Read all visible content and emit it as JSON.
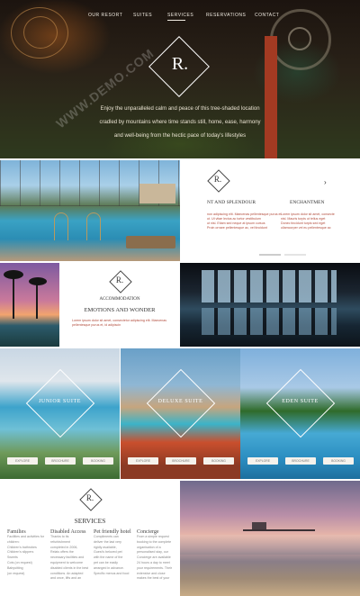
{
  "nav": {
    "items": [
      "OUR RESORT",
      "SUITES",
      "SERVICES",
      "RESERVATIONS",
      "CONTACT"
    ]
  },
  "hero": {
    "logo_letter": "R.",
    "lines": [
      "Enjoy the unparalleled calm and peace of this tree-shaded location",
      "cradled by mountains where time stands still, home, ease, harmony",
      "and well-being from the hectic pace of today's lifestyles"
    ]
  },
  "splendour": {
    "logo_letter": "R.",
    "headings": [
      "NT AND SPLENDOUR",
      "ENCHANTMEN"
    ],
    "text_left": [
      "non adipiscing elit. Maecenas pellentesque purus et",
      "ut. Ut vitae lectus ac tortor vestibulum",
      "ut nisl. Etiam sed neque at ipsum cursus",
      "Proin ornare pellentesque ac, vel tincidunt"
    ],
    "text_right": [
      "Lorem ipsum dolor sit amet, consecte",
      "nisl. Mauris turpis ut tellus eget",
      "Donec tincidunt turpis sed eget",
      "ullamcorper vel eu pellentesque ac"
    ]
  },
  "accommodation": {
    "logo_letter": "R.",
    "kicker": "ACCOMMODATION",
    "title": "EMOTIONS AND WONDER",
    "text": [
      "Lorem ipsum dolor sit amet, consectetur adipiscing elit. Maecenas",
      "pellentesque purus et, id adipiscin"
    ]
  },
  "suites": [
    {
      "name": "JUNIOR SUITE",
      "buttons": [
        "EXPLORE",
        "BROCHURE",
        "BOOKING"
      ]
    },
    {
      "name": "DELUXE SUITE",
      "buttons": [
        "EXPLORE",
        "BROCHURE",
        "BOOKING"
      ]
    },
    {
      "name": "EDEN SUITE",
      "buttons": [
        "EXPLORE",
        "BROCHURE",
        "BOOKING"
      ]
    }
  ],
  "services": {
    "logo_letter": "R.",
    "title": "SERVICES",
    "columns": [
      {
        "heading": "Families",
        "lines": [
          "Facilities and activities for",
          "children:",
          "Children's bathrobes",
          "Children's slippers",
          "Sweets",
          "Cots (on request)",
          "Babysitting",
          "(on request)"
        ]
      },
      {
        "heading": "Disabled Access",
        "lines": [
          "Thanks to its",
          "refurbishment",
          "completed in 2006,",
          "Relais offers the",
          "necessary facilities and",
          "equipment to welcome",
          "disabled clients in the best",
          "conditions. An adapted",
          "and once, lifts and an"
        ]
      },
      {
        "heading": "Pet friendly hotel",
        "lines": [
          "Compliments can",
          "deliver the last very",
          "rigidly available,",
          "Guest's beloved pet",
          "with the name of the",
          "pet can be easily",
          "arranged in advance.",
          "Specific menus and food"
        ]
      },
      {
        "heading": "Concierge",
        "lines": [
          "From a simple request",
          "booking to the complete",
          "organisation of a",
          "personalised stay, our",
          "Concierge are available",
          "24 hours a day to meet",
          "your requirements. Their",
          "extensive and close",
          "makes the best of your"
        ]
      }
    ]
  },
  "watermark": "WWW.DEMO.COM",
  "colors": {
    "accent_red": "#b14a3a",
    "dark": "#333333"
  }
}
